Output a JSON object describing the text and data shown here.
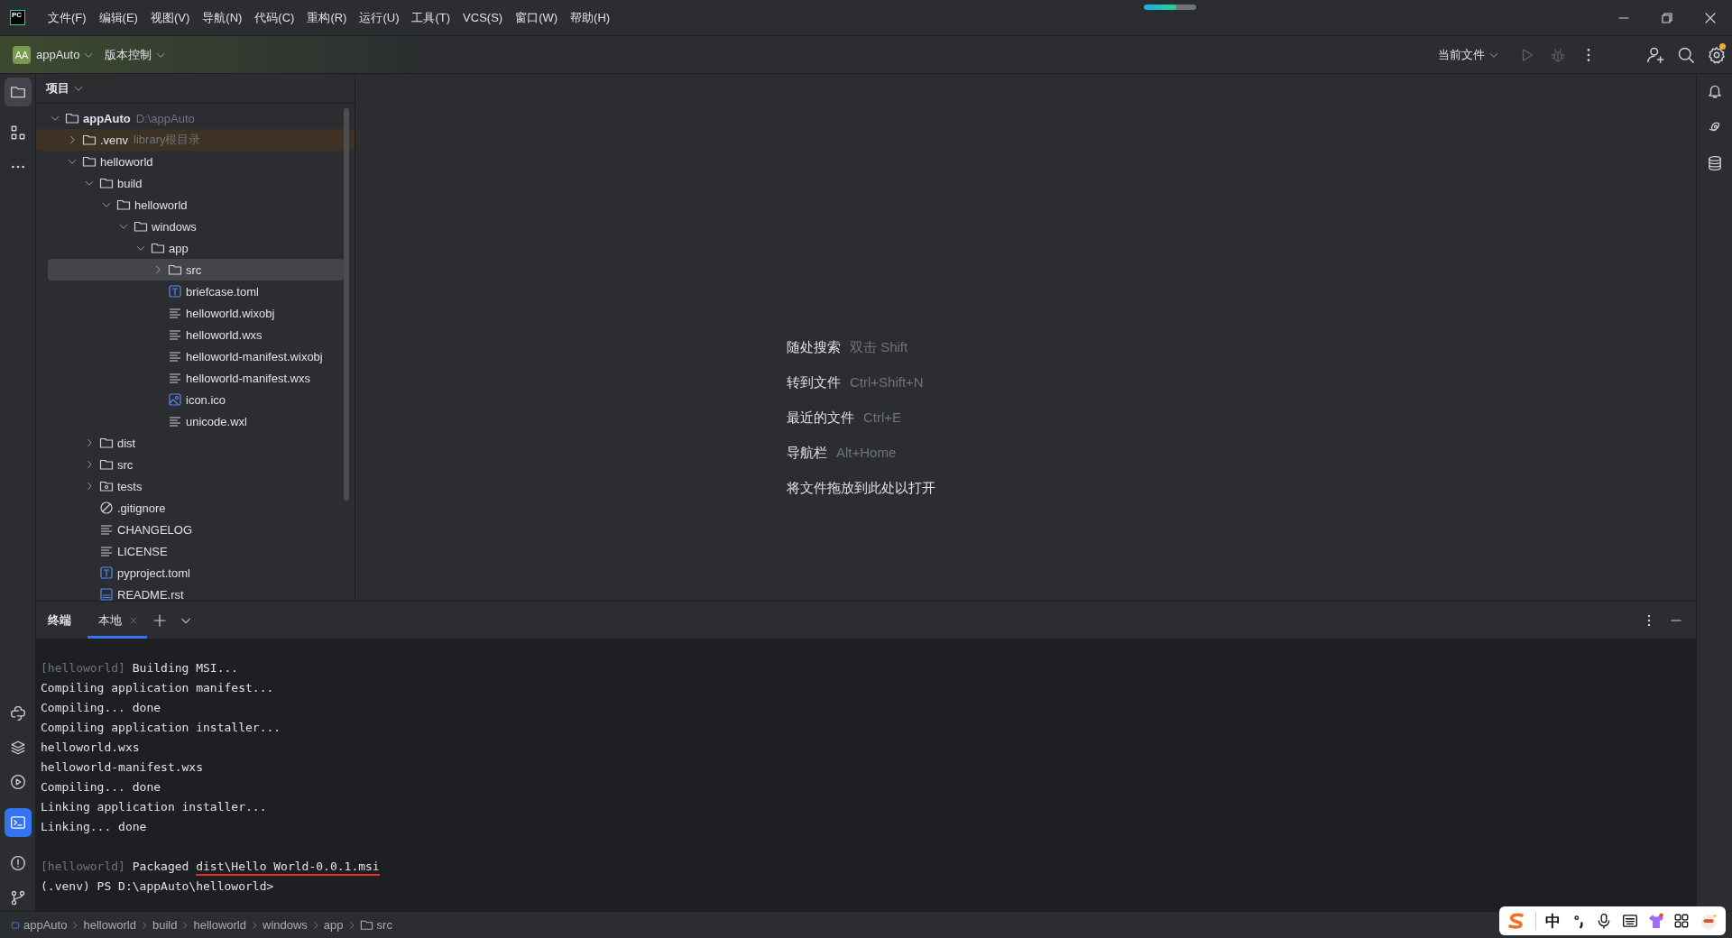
{
  "menu": [
    "文件(F)",
    "编辑(E)",
    "视图(V)",
    "导航(N)",
    "代码(C)",
    "重构(R)",
    "运行(U)",
    "工具(T)",
    "VCS(S)",
    "窗口(W)",
    "帮助(H)"
  ],
  "logo": "PC",
  "progress": {
    "level": 0.62
  },
  "toolbar": {
    "project_badge": "AA",
    "project": "appAuto",
    "vcs": "版本控制",
    "run_config": "当前文件",
    "settings_badge": true
  },
  "project_panel": {
    "title": "项目",
    "tree": [
      {
        "label": "appAuto",
        "hint": "D:\\appAuto",
        "kind": "folder",
        "expanded": true,
        "selected": false,
        "children": [
          {
            "label": ".venv",
            "hint": "library根目录",
            "kind": "library",
            "expanded": false,
            "selected": false
          },
          {
            "label": "helloworld",
            "kind": "folder",
            "expanded": true,
            "selected": false,
            "children": [
              {
                "label": "build",
                "kind": "folder",
                "expanded": true,
                "selected": false,
                "children": [
                  {
                    "label": "helloworld",
                    "kind": "folder",
                    "expanded": true,
                    "selected": false,
                    "children": [
                      {
                        "label": "windows",
                        "kind": "folder",
                        "expanded": true,
                        "selected": false,
                        "children": [
                          {
                            "label": "app",
                            "kind": "folder",
                            "expanded": true,
                            "selected": false,
                            "children": [
                              {
                                "label": "src",
                                "kind": "folder",
                                "expanded": false,
                                "selected": true
                              },
                              {
                                "label": "briefcase.toml",
                                "kind": "toml",
                                "selected": false
                              },
                              {
                                "label": "helloworld.wixobj",
                                "kind": "text",
                                "selected": false
                              },
                              {
                                "label": "helloworld.wxs",
                                "kind": "text",
                                "selected": false
                              },
                              {
                                "label": "helloworld-manifest.wixobj",
                                "kind": "text",
                                "selected": false
                              },
                              {
                                "label": "helloworld-manifest.wxs",
                                "kind": "text",
                                "selected": false
                              },
                              {
                                "label": "icon.ico",
                                "kind": "image",
                                "selected": false
                              },
                              {
                                "label": "unicode.wxl",
                                "kind": "text",
                                "selected": false
                              }
                            ]
                          }
                        ]
                      }
                    ]
                  }
                ]
              },
              {
                "label": "dist",
                "kind": "folder",
                "expanded": false,
                "selected": false
              },
              {
                "label": "src",
                "kind": "folder",
                "expanded": false,
                "selected": false
              },
              {
                "label": "tests",
                "kind": "test-folder",
                "expanded": false,
                "selected": false
              },
              {
                "label": ".gitignore",
                "kind": "ignore",
                "selected": false
              },
              {
                "label": "CHANGELOG",
                "kind": "text",
                "selected": false
              },
              {
                "label": "LICENSE",
                "kind": "text",
                "selected": false
              },
              {
                "label": "pyproject.toml",
                "kind": "toml",
                "selected": false
              },
              {
                "label": "README.rst",
                "kind": "rst",
                "selected": false
              }
            ]
          }
        ]
      }
    ]
  },
  "editor_hints": [
    {
      "label": "随处搜索",
      "shortcut": "双击 Shift"
    },
    {
      "label": "转到文件",
      "shortcut": "Ctrl+Shift+N"
    },
    {
      "label": "最近的文件",
      "shortcut": "Ctrl+E"
    },
    {
      "label": "导航栏",
      "shortcut": "Alt+Home"
    },
    {
      "label": "将文件拖放到此处以打开"
    }
  ],
  "terminal": {
    "title": "终端",
    "tabs": [
      {
        "label": "本地",
        "selected": true
      }
    ],
    "blocks": [
      {
        "lines": [
          {
            "segments": [
              {
                "text": "[helloworld]",
                "kind": "prefix"
              },
              {
                "text": " Building MSI...",
                "kind": "plain"
              }
            ]
          },
          {
            "segments": [
              {
                "text": "Compiling application manifest...",
                "kind": "plain"
              }
            ]
          },
          {
            "segments": [
              {
                "text": "Compiling... done",
                "kind": "plain"
              }
            ]
          },
          {
            "segments": [
              {
                "text": "Compiling application installer...",
                "kind": "plain"
              }
            ]
          },
          {
            "segments": [
              {
                "text": "helloworld.wxs",
                "kind": "plain"
              }
            ]
          },
          {
            "segments": [
              {
                "text": "helloworld-manifest.wxs",
                "kind": "plain"
              }
            ]
          },
          {
            "segments": [
              {
                "text": "Compiling... done",
                "kind": "plain"
              }
            ]
          },
          {
            "segments": [
              {
                "text": "Linking application installer...",
                "kind": "plain"
              }
            ]
          },
          {
            "segments": [
              {
                "text": "Linking... done",
                "kind": "plain"
              }
            ]
          }
        ]
      },
      {
        "lines": [
          {
            "segments": [
              {
                "text": "[helloworld]",
                "kind": "prefix"
              },
              {
                "text": " Packaged ",
                "kind": "plain"
              },
              {
                "text": "dist\\Hello World-0.0.1.msi",
                "kind": "link"
              }
            ]
          },
          {
            "segments": [
              {
                "text": "(.venv) PS D:\\appAuto\\helloworld>",
                "kind": "plain"
              }
            ]
          }
        ]
      }
    ]
  },
  "breadcrumbs": [
    {
      "label": "appAuto",
      "kind": "module"
    },
    {
      "label": "helloworld",
      "kind": "plain"
    },
    {
      "label": "build",
      "kind": "plain"
    },
    {
      "label": "helloworld",
      "kind": "plain"
    },
    {
      "label": "windows",
      "kind": "plain"
    },
    {
      "label": "app",
      "kind": "plain"
    },
    {
      "label": "src",
      "kind": "folder"
    }
  ],
  "ime_bar": {
    "mode": "中"
  }
}
